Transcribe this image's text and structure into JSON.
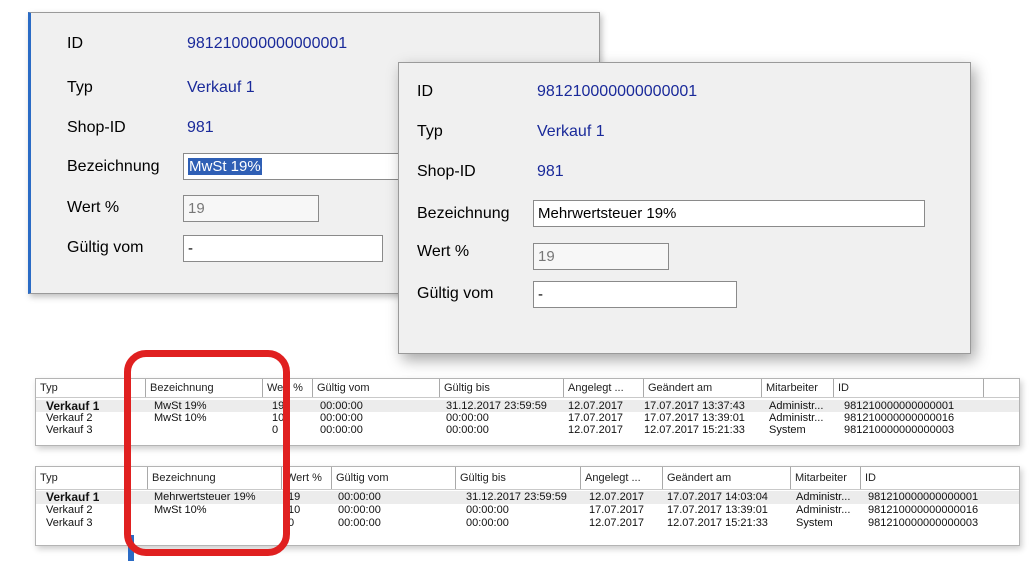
{
  "dialog_old": {
    "id_label": "ID",
    "id_value": "981210000000000001",
    "typ_label": "Typ",
    "typ_value": "Verkauf 1",
    "shop_label": "Shop-ID",
    "shop_value": "981",
    "bez_label": "Bezeichnung",
    "bez_value": "MwSt 19%",
    "wert_label": "Wert %",
    "wert_value": "19",
    "gueltig_label": "Gültig vom",
    "gueltig_value": "-"
  },
  "dialog_new": {
    "id_label": "ID",
    "id_value": "981210000000000001",
    "typ_label": "Typ",
    "typ_value": "Verkauf 1",
    "shop_label": "Shop-ID",
    "shop_value": "981",
    "bez_label": "Bezeichnung",
    "bez_value": "Mehrwertsteuer 19%",
    "wert_label": "Wert %",
    "wert_value": "19",
    "gueltig_label": "Gültig vom",
    "gueltig_value": "-"
  },
  "grid_old": {
    "headers": [
      "Typ",
      "Bezeichnung",
      "Wert %",
      "Gültig vom",
      "Gültig bis",
      "Angelegt ...",
      "Geändert am",
      "Mitarbeiter",
      "ID"
    ],
    "rows": [
      [
        "Verkauf 1",
        "MwSt 19%",
        "19",
        "00:00:00",
        "31.12.2017 23:59:59",
        "12.07.2017",
        "17.07.2017 13:37:43",
        "Administr...",
        "981210000000000001"
      ],
      [
        "Verkauf 2",
        "MwSt 10%",
        "10",
        "00:00:00",
        "00:00:00",
        "17.07.2017",
        "17.07.2017 13:39:01",
        "Administr...",
        "981210000000000016"
      ],
      [
        "Verkauf 3",
        "",
        "0",
        "00:00:00",
        "00:00:00",
        "12.07.2017",
        "12.07.2017 15:21:33",
        "System",
        "981210000000000003"
      ]
    ]
  },
  "grid_new": {
    "headers": [
      "Typ",
      "Bezeichnung",
      "Wert %",
      "Gültig vom",
      "Gültig bis",
      "Angelegt ...",
      "Geändert am",
      "Mitarbeiter",
      "ID"
    ],
    "rows": [
      [
        "Verkauf 1",
        "Mehrwertsteuer 19%",
        "19",
        "00:00:00",
        "31.12.2017 23:59:59",
        "12.07.2017",
        "17.07.2017 14:03:04",
        "Administr...",
        "981210000000000001"
      ],
      [
        "Verkauf 2",
        "MwSt 10%",
        "10",
        "00:00:00",
        "00:00:00",
        "17.07.2017",
        "17.07.2017 13:39:01",
        "Administr...",
        "981210000000000016"
      ],
      [
        "Verkauf 3",
        "",
        "0",
        "00:00:00",
        "00:00:00",
        "12.07.2017",
        "12.07.2017 15:21:33",
        "System",
        "981210000000000003"
      ]
    ]
  },
  "colors": {
    "highlight": "#e02020",
    "value_text": "#1a2a9a",
    "selection": "#2f5fb5"
  }
}
